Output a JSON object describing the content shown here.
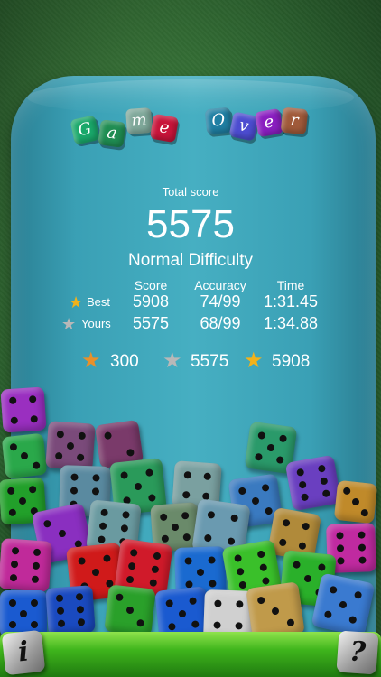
{
  "title": {
    "word1": [
      "G",
      "a",
      "m",
      "e"
    ],
    "word2": [
      "O",
      "v",
      "e",
      "r"
    ]
  },
  "colors": {
    "cup": "#3aa0b5",
    "felt": "#2f6d34",
    "tray": "#3fb51c",
    "star_gold": "#f2b21b",
    "star_silver": "#b8b8b8",
    "star_bronze": "#e8902a"
  },
  "summary": {
    "total_label": "Total score",
    "total_value": "5575",
    "difficulty": "Normal Difficulty"
  },
  "table": {
    "headers": [
      "Score",
      "Accuracy",
      "Time"
    ],
    "rows": [
      {
        "label": "Best",
        "star_icon": "gold-star-icon",
        "score": "5908",
        "accuracy": "74/99",
        "time": "1:31.45"
      },
      {
        "label": "Yours",
        "star_icon": "silver-star-icon",
        "score": "5575",
        "accuracy": "68/99",
        "time": "1:34.88"
      }
    ]
  },
  "medals": [
    {
      "icon": "bronze-star-icon",
      "value": "300"
    },
    {
      "icon": "silver-star-icon",
      "value": "5575"
    },
    {
      "icon": "gold-star-icon",
      "value": "5908"
    }
  ],
  "corner_buttons": {
    "left_icon": "info-die-icon",
    "right_icon": "help-die-icon",
    "left_glyph": "i",
    "right_glyph": "?"
  }
}
